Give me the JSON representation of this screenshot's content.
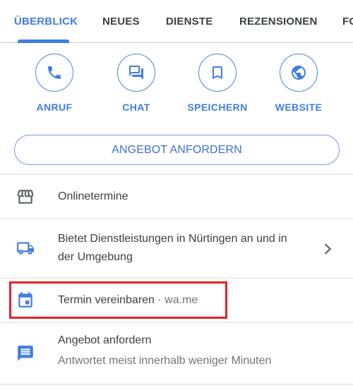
{
  "tabs": [
    {
      "label": "ÜBERBLICK",
      "active": true
    },
    {
      "label": "NEUES",
      "active": false
    },
    {
      "label": "DIENSTE",
      "active": false
    },
    {
      "label": "REZENSIONEN",
      "active": false
    },
    {
      "label": "FO",
      "active": false
    }
  ],
  "actions": [
    {
      "label": "ANRUF",
      "icon": "phone-icon"
    },
    {
      "label": "CHAT",
      "icon": "chat-icon"
    },
    {
      "label": "SPEICHERN",
      "icon": "bookmark-icon"
    },
    {
      "label": "WEBSITE",
      "icon": "globe-icon"
    }
  ],
  "quote_button": {
    "label": "ANGEBOT ANFORDERN"
  },
  "list": [
    {
      "icon": "storefront-icon",
      "text": "Onlinetermine"
    },
    {
      "icon": "truck-icon",
      "line1": "Bietet Dienstleistungen in Nürtingen an und in",
      "line2": "der Umgebung",
      "chevron": "chevron-right-icon"
    },
    {
      "icon": "calendar-icon",
      "text": "Termin vereinbaren",
      "separator": " · ",
      "domain": "wa.me",
      "highlighted": true
    },
    {
      "icon": "message-icon",
      "title": "Angebot anfordern",
      "subtitle": "Antwortet meist innerhalb weniger Minuten"
    }
  ],
  "colors": {
    "accent": "#3f7ee2",
    "highlight_box": "#e8202a",
    "text_primary": "#3c4043",
    "text_secondary": "#70757a",
    "icon_gray": "#5f6368"
  }
}
